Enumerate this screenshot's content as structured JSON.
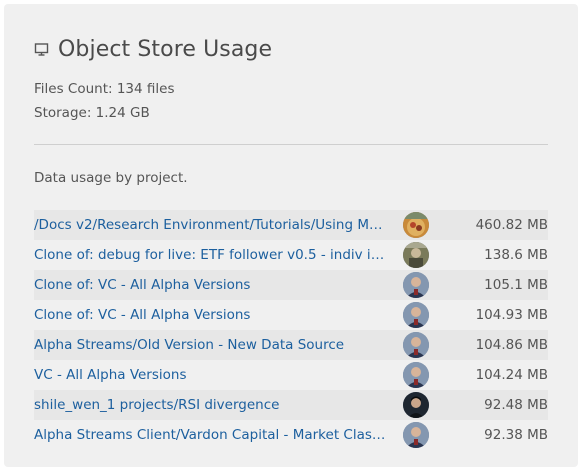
{
  "header": {
    "icon": "monitor-icon",
    "title": "Object Store Usage"
  },
  "stats": {
    "files_count": "Files Count: 134 files",
    "storage": "Storage: 1.24 GB"
  },
  "caption": "Data usage by project.",
  "projects": [
    {
      "name": "/Docs v2/Research Environment/Tutorials/Using Ma...",
      "size": "460.82 MB",
      "avatar": "avatar-food"
    },
    {
      "name": "Clone of: debug for live: ETF follower v0.5 - indiv in...",
      "size": "138.6 MB",
      "avatar": "avatar-outdoor"
    },
    {
      "name": "Clone of: VC - All Alpha Versions",
      "size": "105.1 MB",
      "avatar": "avatar-person"
    },
    {
      "name": "Clone of: VC - All Alpha Versions",
      "size": "104.93 MB",
      "avatar": "avatar-person"
    },
    {
      "name": "Alpha Streams/Old Version - New Data Source",
      "size": "104.86 MB",
      "avatar": "avatar-person"
    },
    {
      "name": "VC - All Alpha Versions",
      "size": "104.24 MB",
      "avatar": "avatar-person"
    },
    {
      "name": "shile_wen_1 projects/RSI divergence",
      "size": "92.48 MB",
      "avatar": "avatar-dark"
    },
    {
      "name": "Alpha Streams Client/Vardon Capital - Market Class...",
      "size": "92.38 MB",
      "avatar": "avatar-person"
    }
  ],
  "colors": {
    "link": "#1c5f9e",
    "card_bg": "#f0f0f0",
    "row_alt": "#e7e7e7"
  }
}
